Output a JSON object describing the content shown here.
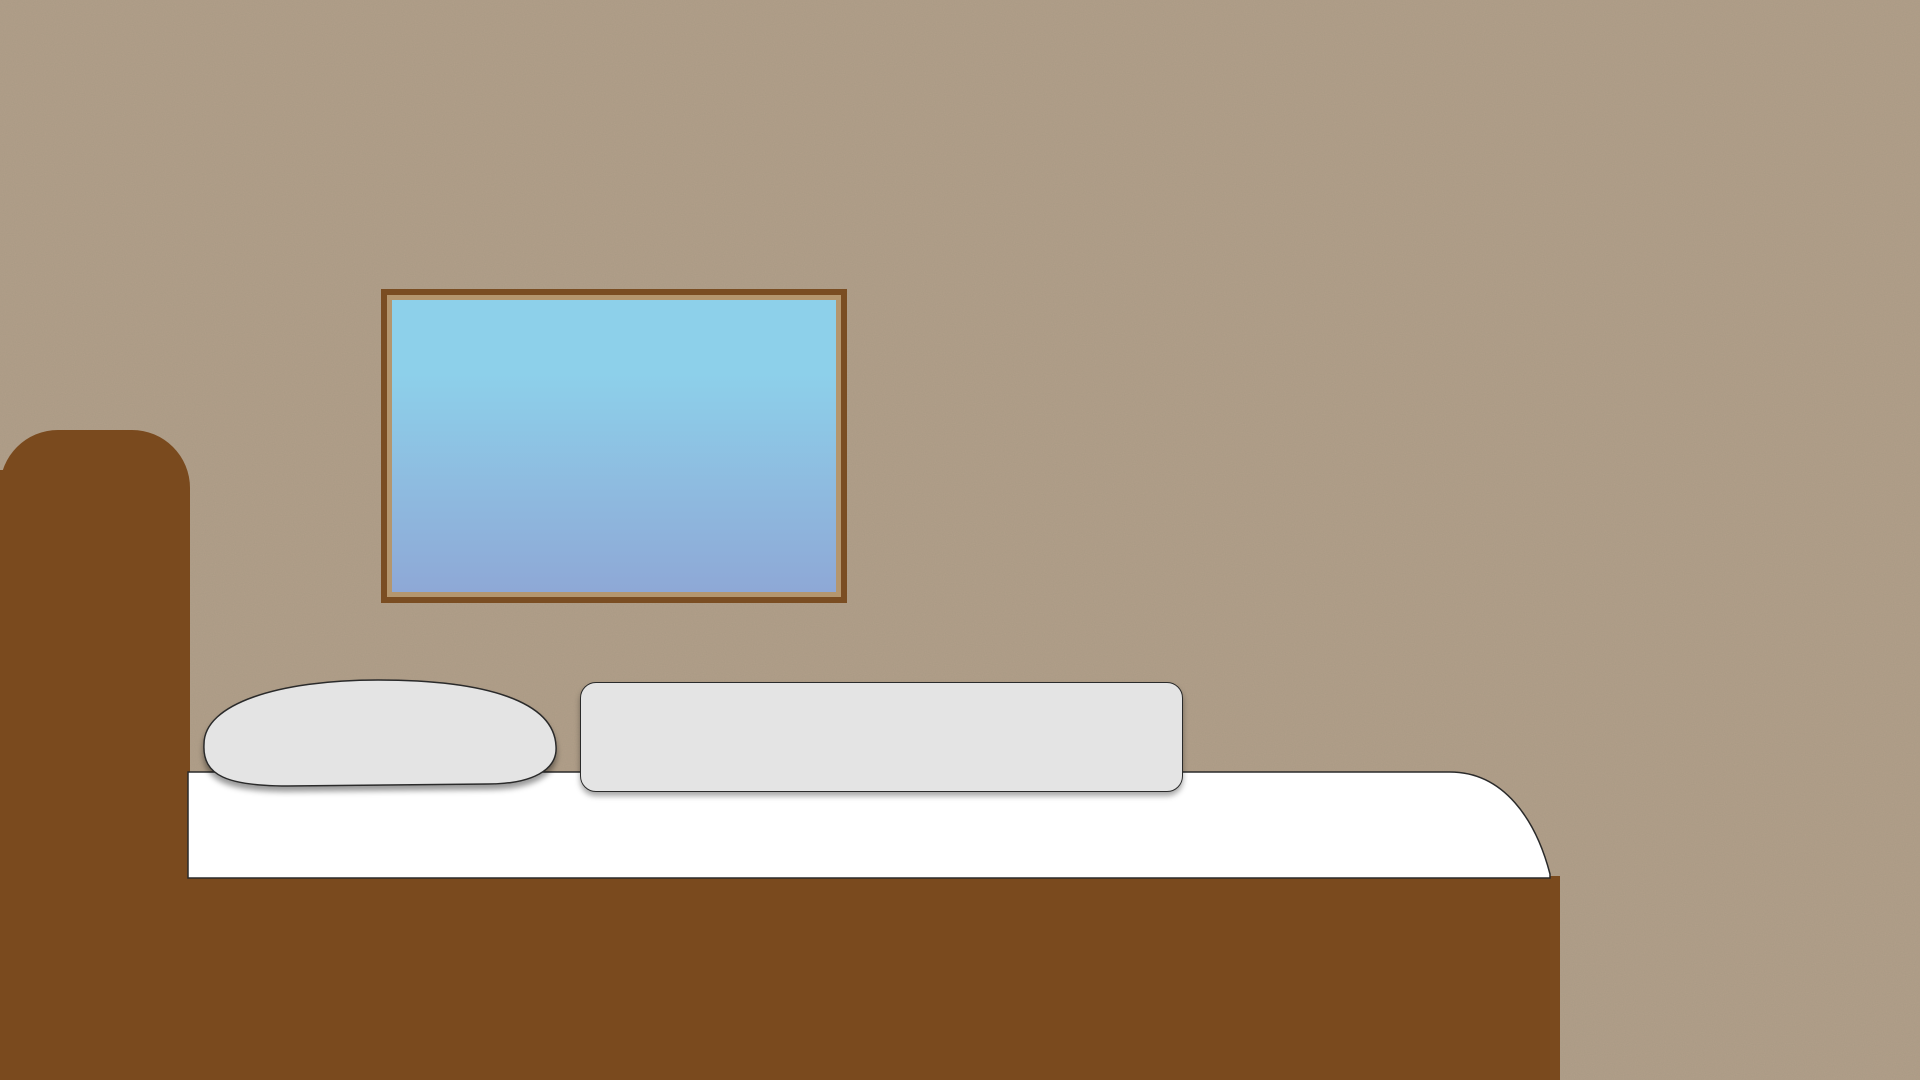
{
  "scene": {
    "wall": {
      "color": "#b09e88",
      "texture": "speckled"
    },
    "window": {
      "frame_color": "#7a4d22",
      "trim_color": "#b4966e",
      "sky_top_color": "#8dd0ea",
      "sky_bottom_color": "#8ea8d6"
    },
    "bed": {
      "wood_color": "#7a4a1e",
      "sheet_color": "#ffffff",
      "pillow_color": "#e4e4e4",
      "bolster_color": "#e4e4e4",
      "outline_color": "#2a2a2a"
    }
  }
}
